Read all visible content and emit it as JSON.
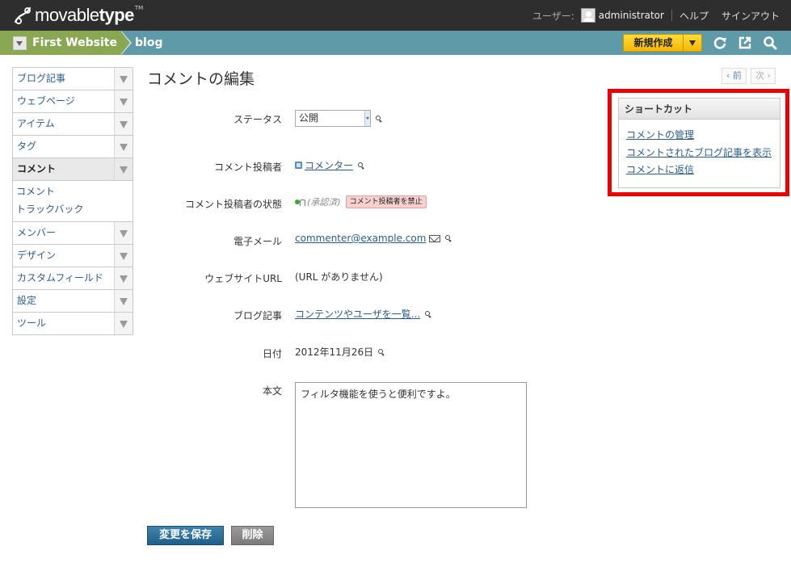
{
  "header": {
    "logo": {
      "text_light": "movable",
      "text_bold": "type",
      "tm": "TM"
    },
    "user_label": "ユーザー:",
    "user_name": "administrator",
    "help": "ヘルプ",
    "signout": "サインアウト"
  },
  "scope": {
    "site": "First Website",
    "blog": "blog",
    "new_button": "新規作成"
  },
  "sidebar": {
    "items": [
      {
        "label": "ブログ記事"
      },
      {
        "label": "ウェブページ"
      },
      {
        "label": "アイテム"
      },
      {
        "label": "タグ"
      },
      {
        "label": "コメント",
        "active": true
      },
      {
        "label": "メンバー"
      },
      {
        "label": "デザイン"
      },
      {
        "label": "カスタムフィールド"
      },
      {
        "label": "設定"
      },
      {
        "label": "ツール"
      }
    ],
    "submenu": [
      "コメント",
      "トラックバック"
    ]
  },
  "page": {
    "title": "コメントの編集",
    "prev": "‹ 前",
    "next": "次 ›"
  },
  "form": {
    "status": {
      "label": "ステータス",
      "value": "公開"
    },
    "commenter": {
      "label": "コメント投稿者",
      "value": "コメンター"
    },
    "commenter_status": {
      "label": "コメント投稿者の状態",
      "value": "(承認済)",
      "ban": "コメント投稿者を禁止"
    },
    "email": {
      "label": "電子メール",
      "value": "commenter@example.com"
    },
    "url": {
      "label": "ウェブサイトURL",
      "value": "(URL がありません)"
    },
    "entry": {
      "label": "ブログ記事",
      "value": "コンテンツやユーザを一覧..."
    },
    "date": {
      "label": "日付",
      "value": "2012年11月26日"
    },
    "body": {
      "label": "本文",
      "value": "フィルタ機能を使うと便利ですよ。"
    }
  },
  "actions": {
    "save": "変更を保存",
    "delete": "削除"
  },
  "shortcuts": {
    "title": "ショートカット",
    "links": [
      "コメントの管理",
      "コメントされたブログ記事を表示",
      "コメントに返信"
    ]
  },
  "colors": {
    "accent_highlight": "#ee0000",
    "topbar": "#2e2e2e",
    "scopebar": "#5f9aa9",
    "site_crumb": "#8aa853",
    "new_button": "#f5b800"
  }
}
